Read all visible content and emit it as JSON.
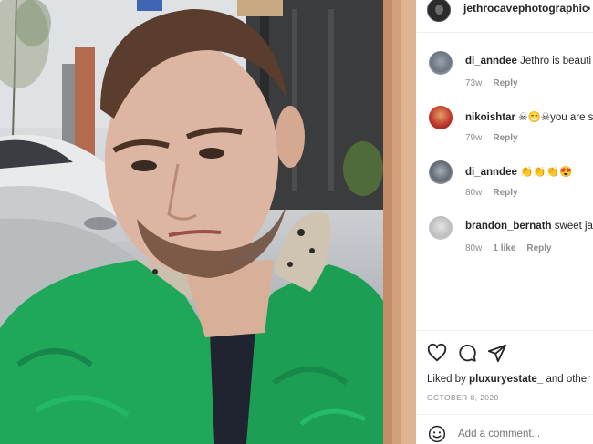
{
  "post": {
    "author": "jethrocavephotographic",
    "separator": "•",
    "avatar_icon": "profile-avatar-icon"
  },
  "comments": [
    {
      "username": "di_anndee",
      "text": "Jethro is beauti",
      "age": "73w",
      "likes": "",
      "reply": "Reply"
    },
    {
      "username": "nikoishtar",
      "text": "☠😁☠you are s",
      "age": "79w",
      "likes": "",
      "reply": "Reply"
    },
    {
      "username": "di_anndee",
      "text": "👏👏👏😍",
      "age": "80w",
      "likes": "",
      "reply": "Reply"
    },
    {
      "username": "brandon_bernath",
      "text": "sweet ja",
      "age": "80w",
      "likes": "1 like",
      "reply": "Reply"
    }
  ],
  "actions": {
    "like_icon": "heart-icon",
    "comment_icon": "comment-bubble-icon",
    "share_icon": "paper-plane-icon"
  },
  "likes_line": {
    "prefix": "Liked by",
    "user": "pluxuryestate_",
    "suffix": "and other"
  },
  "date": "OCTOBER 8, 2020",
  "add_comment": {
    "placeholder": "Add a comment...",
    "emoji_icon": "smiley-icon"
  },
  "colors": {
    "jacket_green": "#1fa85a",
    "divider": "#efefef",
    "meta_gray": "#8e8e8e"
  }
}
